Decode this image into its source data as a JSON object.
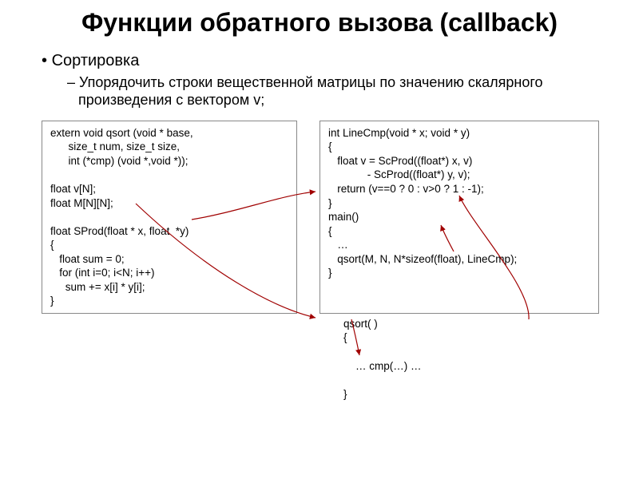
{
  "title": "Функции обратного вызова (callback)",
  "bullet_main": "Сортировка",
  "bullet_sub": "Упорядочить строки вещественной матрицы по значению скалярного произведения с вектором v;",
  "code_left": "extern void qsort (void * base,\n      size_t num, size_t size,\n      int (*cmp) (void *,void *));\n\nfloat v[N];\nfloat M[N][N];\n\nfloat SProd(float * x, float  *y)\n{\n   float sum = 0;\n   for (int i=0; i<N; i++)\n     sum += x[i] * y[i];\n}",
  "code_right": "int LineCmp(void * x; void * y)\n{\n   float v = ScProd((float*) x, v)\n             - ScProd((float*) y, v);\n   return (v==0 ? 0 : v>0 ? 1 : -1);\n}\nmain()\n{\n   …\n   qsort(M, N, N*sizeof(float), LineCmp);\n}",
  "code_tail": "qsort( )\n{\n\n    … cmp(…) …\n\n}"
}
